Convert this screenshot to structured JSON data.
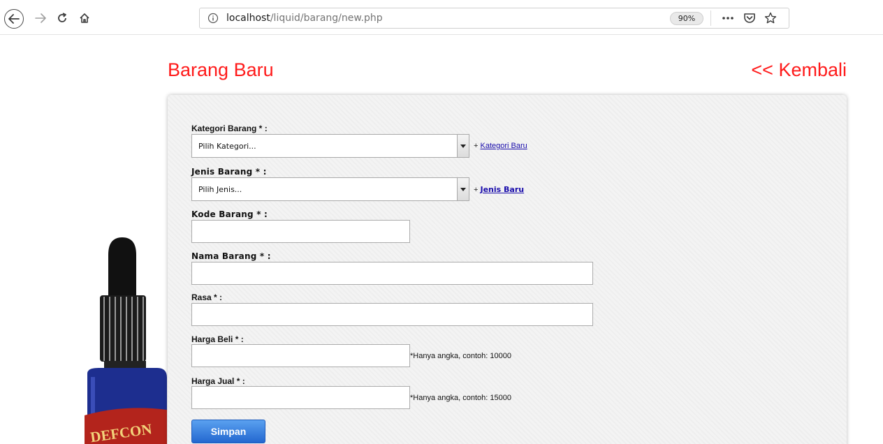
{
  "browser": {
    "url_host": "localhost",
    "url_path": "/liquid/barang/new.php",
    "zoom": "90%",
    "icons": [
      "back-icon",
      "forward-icon",
      "reload-icon",
      "home-icon",
      "info-icon",
      "more-icon",
      "pocket-icon",
      "bookmark-star-icon"
    ]
  },
  "page": {
    "title": "Barang Baru",
    "back_link": "<< Kembali"
  },
  "form": {
    "kategori": {
      "label": "Kategori Barang * :",
      "selected": "Pilih Kategori...",
      "add_prefix": "+ ",
      "add_link": "Kategori Baru"
    },
    "jenis": {
      "label": "Jenis Barang * :",
      "selected": "Pilih Jenis...",
      "add_prefix": "+ ",
      "add_link": "Jenis Baru"
    },
    "kode": {
      "label": "Kode Barang * :",
      "value": ""
    },
    "nama": {
      "label": "Nama Barang * :",
      "value": ""
    },
    "rasa": {
      "label": "Rasa * :",
      "value": ""
    },
    "harga_beli": {
      "label": "Harga Beli * :",
      "value": "",
      "hint": "*Hanya angka, contoh: 10000"
    },
    "harga_jual": {
      "label": "Harga Jual * :",
      "value": "",
      "hint": "*Hanya angka, contoh: 15000"
    },
    "submit_label": "Simpan"
  },
  "colors": {
    "title_red": "#ff1a1a",
    "link_blue": "#1a0dab",
    "button_blue": "#2367d0"
  },
  "product_image": {
    "label_text": "DEFCON"
  }
}
